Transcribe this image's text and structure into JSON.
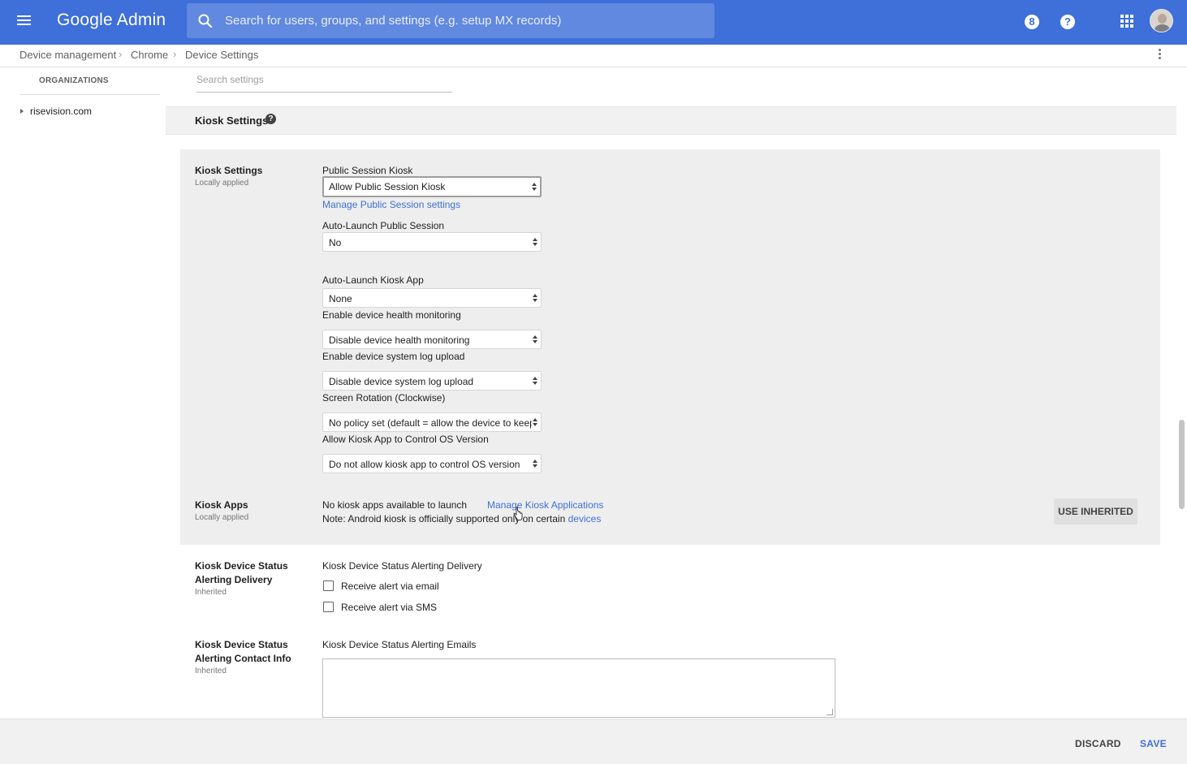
{
  "app": {
    "title": "Google Admin"
  },
  "search": {
    "placeholder": "Search for users, groups, and settings (e.g. setup MX records)"
  },
  "topbar": {
    "icons": [
      "menu-icon",
      "search-icon",
      "support-icon",
      "help-icon",
      "apps-grid-icon",
      "account-avatar"
    ],
    "support_glyph": "8",
    "help_glyph": "?"
  },
  "breadcrumb": [
    "Device management",
    "Chrome",
    "Device Settings"
  ],
  "breadcrumb_sep": "›",
  "sidebar": {
    "title": "ORGANIZATIONS",
    "items": [
      {
        "label": "risevision.com"
      }
    ]
  },
  "settings_search": {
    "placeholder": "Search settings"
  },
  "section": {
    "title": "Kiosk Settings",
    "help_glyph": "?"
  },
  "kiosk_settings": {
    "name": "Kiosk Settings",
    "status": "Locally applied",
    "public_session_kiosk": {
      "label": "Public Session Kiosk",
      "value": "Allow Public Session Kiosk",
      "link": "Manage Public Session settings"
    },
    "auto_launch_public_session": {
      "label": "Auto-Launch Public Session",
      "value": "No"
    },
    "auto_launch_kiosk_app": {
      "label": "Auto-Launch Kiosk App",
      "value": "None"
    },
    "health_monitoring": {
      "label": "Enable device health monitoring",
      "value": "Disable device health monitoring"
    },
    "system_log_upload": {
      "label": "Enable device system log upload",
      "value": "Disable device system log upload"
    },
    "screen_rotation": {
      "label": "Screen Rotation (Clockwise)",
      "value": "No policy set (default = allow the device to keep its current rotation)"
    },
    "os_version_control": {
      "label": "Allow Kiosk App to Control OS Version",
      "value": "Do not allow kiosk app to control OS version"
    }
  },
  "kiosk_apps": {
    "name": "Kiosk Apps",
    "status": "Locally applied",
    "empty_text": "No kiosk apps available to launch",
    "manage_link": "Manage Kiosk Applications",
    "note_prefix": "Note: Android kiosk is officially supported only on certain",
    "note_link": "devices",
    "use_inherited": "USE INHERITED"
  },
  "alerting_delivery": {
    "name_line1": "Kiosk Device Status",
    "name_line2": "Alerting Delivery",
    "status": "Inherited",
    "label": "Kiosk Device Status Alerting Delivery",
    "options": [
      {
        "label": "Receive alert via email",
        "checked": false
      },
      {
        "label": "Receive alert via SMS",
        "checked": false
      }
    ]
  },
  "alerting_contact": {
    "name_line1": "Kiosk Device Status",
    "name_line2": "Alerting Contact Info",
    "status": "Inherited",
    "label": "Kiosk Device Status Alerting Emails",
    "value": ""
  },
  "footer": {
    "discard": "DISCARD",
    "save": "SAVE"
  },
  "colors": {
    "brand": "#3f6fd8",
    "panel": "#eeeeee",
    "link": "#3f6fd8"
  }
}
